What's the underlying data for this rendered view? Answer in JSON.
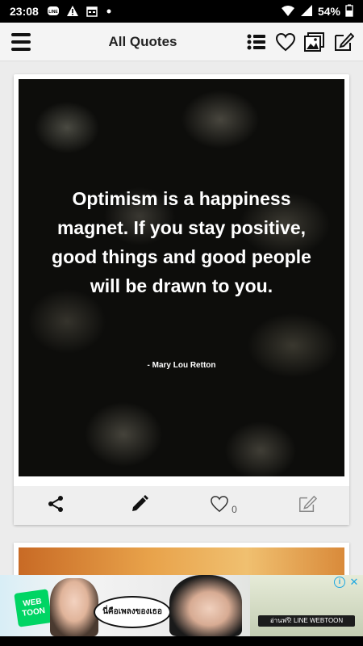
{
  "status_bar": {
    "time": "23:08",
    "battery": "54%",
    "icons": [
      "line-icon",
      "warning-icon",
      "calendar-icon",
      "dot-icon",
      "wifi-icon",
      "signal-icon",
      "battery-icon"
    ]
  },
  "toolbar": {
    "title": "All Quotes",
    "icons": [
      "menu-icon",
      "list-icon",
      "heart-icon",
      "gallery-icon",
      "compose-icon"
    ]
  },
  "quote_card": {
    "text": "Optimism is a happiness magnet. If you stay positive, good things and good people will be drawn to you.",
    "author": "- Mary Lou Retton",
    "like_count": "0",
    "actions": [
      "share-icon",
      "edit-icon",
      "heart-icon",
      "compose-icon"
    ]
  },
  "ad": {
    "logo_text": "WEB TOON",
    "bubble_text": "นี่คือเพลงของเธอ",
    "caption": "อ่านฟรี! LINE WEBTOON",
    "info_label": "i",
    "close_label": "✕",
    "accent": "#00d564"
  },
  "colors": {
    "status_bar": "#000000",
    "toolbar": "#f4f4f4",
    "background": "#ececec",
    "quote_text": "#ffffff"
  }
}
